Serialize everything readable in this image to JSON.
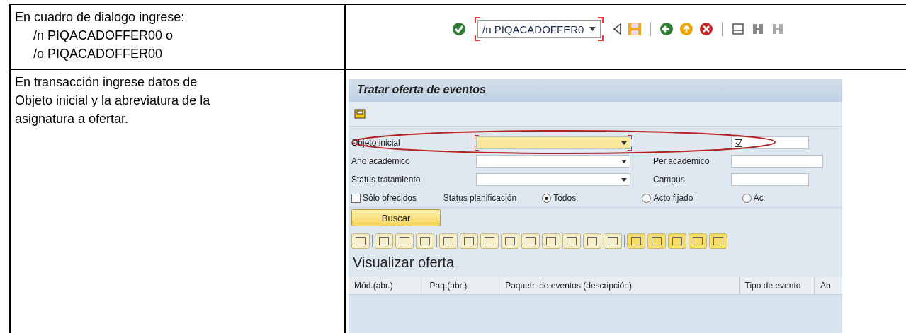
{
  "steps": [
    {
      "lines": [
        "En cuadro de dialogo ingrese:",
        "/n PIQACADOFFER00 o",
        "/o PIQACADOFFER00"
      ]
    },
    {
      "lines": [
        "En transacción ingrese datos de Objeto inicial y la abreviatura de la asignatura a ofertar."
      ]
    }
  ],
  "command_field": {
    "value": "/n PIQACADOFFER0",
    "focused": true
  },
  "sap": {
    "title": "Tratar oferta de eventos",
    "form_rows": [
      {
        "label": "Objeto inicial",
        "focused": true,
        "circled": true,
        "right_label": "",
        "right_check": true
      },
      {
        "label": "Año académico",
        "focused": false,
        "circled": false,
        "right_label": "Per.académico",
        "right_check": false
      },
      {
        "label": "Status tratamiento",
        "focused": false,
        "circled": false,
        "right_label": "Campus",
        "right_check": false
      }
    ],
    "only_offered": {
      "label": "Sólo ofrecidos",
      "checked": false
    },
    "status_label": "Status planificación",
    "radios": [
      {
        "label": "Todos",
        "selected": true
      },
      {
        "label": "Acto fijado",
        "selected": false
      },
      {
        "label": "Ac",
        "selected": false
      }
    ],
    "search_button": "Buscar",
    "section_title": "Visualizar oferta",
    "columns": [
      "Mód.(abr.)",
      "Paq.(abr.)",
      "Paquete de eventos (descripción)",
      "Tipo de evento",
      "Ab"
    ]
  }
}
